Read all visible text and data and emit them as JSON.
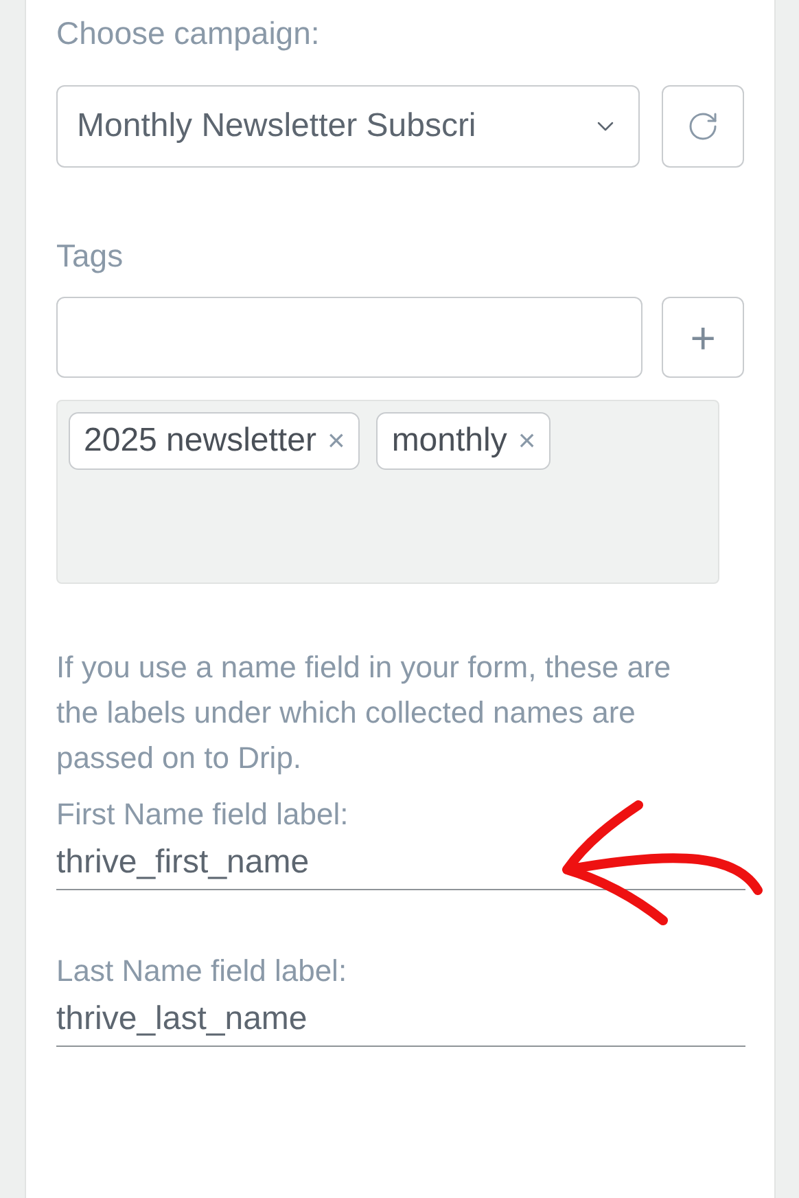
{
  "campaign": {
    "label": "Choose campaign:",
    "value": "Monthly Newsletter Subscri"
  },
  "tags": {
    "label": "Tags",
    "items": [
      "2025 newsletter",
      "monthly"
    ],
    "remove_symbol": "×",
    "add_symbol": "+"
  },
  "help_text": "If you use a name field in your form, these are the labels under which collected names are passed on to Drip.",
  "fields": [
    {
      "label": "First Name field label:",
      "value": "thrive_first_name"
    },
    {
      "label": "Last Name field label:",
      "value": "thrive_last_name"
    }
  ],
  "annotation": {
    "kind": "arrow"
  }
}
